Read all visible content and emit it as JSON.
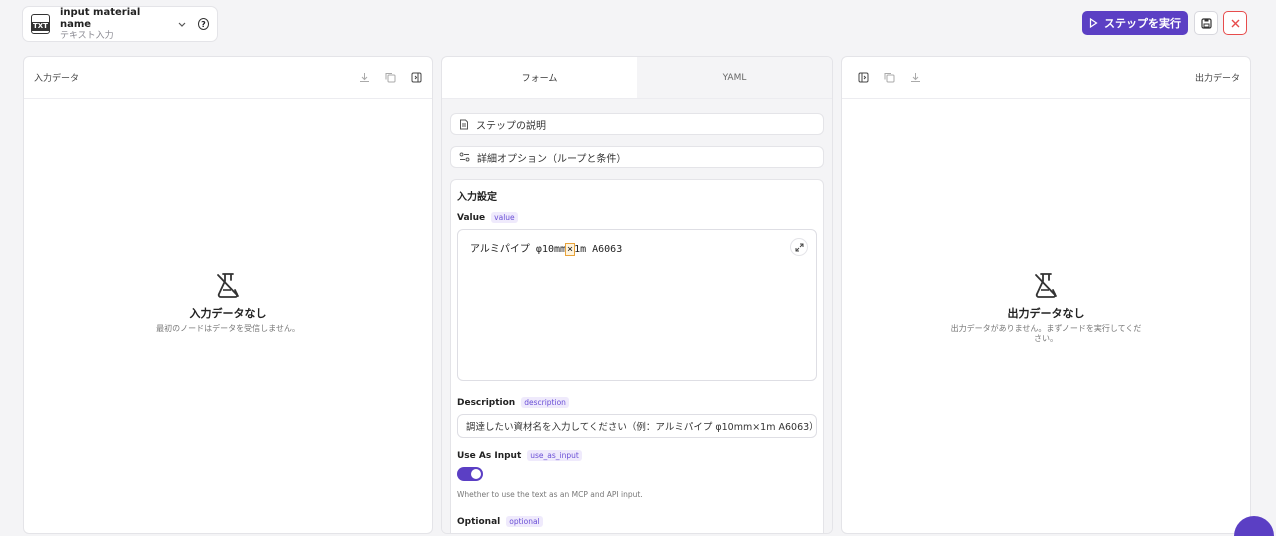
{
  "header": {
    "node_name": "input material name",
    "node_type": "テキスト入力",
    "icon_badge": "TXT",
    "run_label": "ステップを実行"
  },
  "input_panel": {
    "title": "入力データ",
    "empty_title": "入力データなし",
    "empty_subtitle": "最初のノードはデータを受信しません。"
  },
  "output_panel": {
    "title": "出力データ",
    "empty_title": "出力データなし",
    "empty_subtitle_line1": "出力データがありません。まずノードを実行してくだ",
    "empty_subtitle_line2": "さい。"
  },
  "tabs": [
    {
      "label": "フォーム",
      "active": true
    },
    {
      "label": "YAML",
      "active": false
    }
  ],
  "form": {
    "step_description_label": "ステップの説明",
    "advanced_options_label": "詳細オプション（ループと条件）",
    "section_title": "入力設定",
    "value": {
      "label": "Value",
      "key": "value",
      "text_before": "アルミパイプ φ10mm",
      "text_cursor": "×",
      "text_after": "1m A6063"
    },
    "description": {
      "label": "Description",
      "key": "description",
      "value": "調達したい資材名を入力してください（例：アルミパイプ φ10mm×1m A6063）"
    },
    "use_as_input": {
      "label": "Use As Input",
      "key": "use_as_input",
      "enabled": true,
      "hint": "Whether to use the text as an MCP and API input."
    },
    "optional": {
      "label": "Optional",
      "key": "optional"
    }
  },
  "colors": {
    "accent": "#5b3fc4",
    "danger": "#e74c4c",
    "chip_bg": "#efeafc"
  }
}
